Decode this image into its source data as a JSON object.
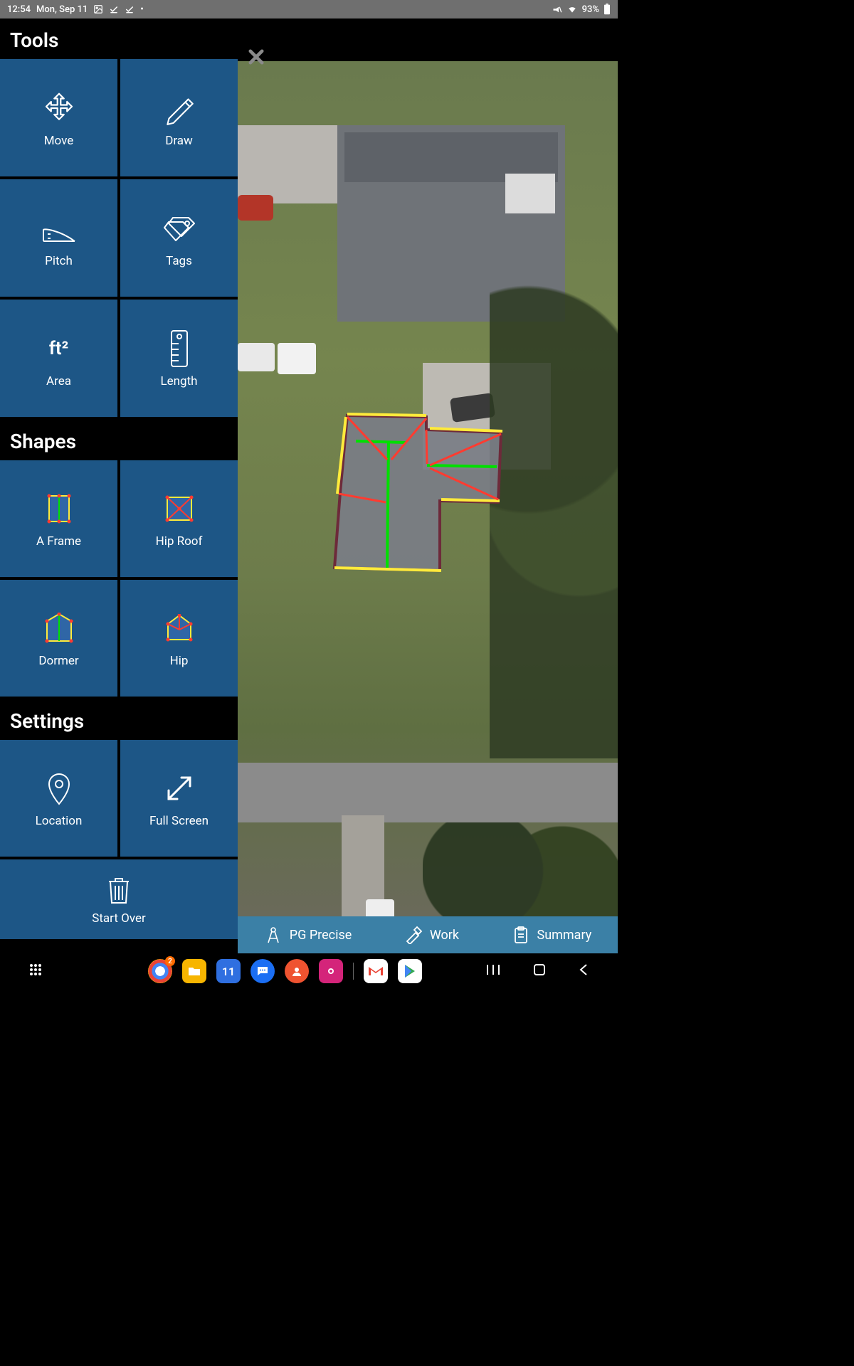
{
  "status_bar": {
    "time": "12:54",
    "date": "Mon, Sep 11",
    "battery_pct": "93%",
    "icons": {
      "mute": "mute-icon",
      "wifi": "wifi-icon",
      "battery": "battery-icon",
      "photo": "photo-icon",
      "check1": "check-icon",
      "check2": "check-icon",
      "dot": "•"
    }
  },
  "sidebar": {
    "sections": {
      "tools_title": "Tools",
      "shapes_title": "Shapes",
      "settings_title": "Settings"
    },
    "tools": [
      {
        "id": "move",
        "label": "Move",
        "icon": "move-icon"
      },
      {
        "id": "draw",
        "label": "Draw",
        "icon": "pencil-icon"
      },
      {
        "id": "pitch",
        "label": "Pitch",
        "icon": "protractor-icon"
      },
      {
        "id": "tags",
        "label": "Tags",
        "icon": "tags-icon"
      },
      {
        "id": "area",
        "label": "Area",
        "icon_text": "ft²"
      },
      {
        "id": "length",
        "label": "Length",
        "icon": "ruler-icon"
      }
    ],
    "shapes": [
      {
        "id": "a-frame",
        "label": "A Frame"
      },
      {
        "id": "hip-roof",
        "label": "Hip Roof"
      },
      {
        "id": "dormer",
        "label": "Dormer"
      },
      {
        "id": "hip",
        "label": "Hip"
      }
    ],
    "settings": [
      {
        "id": "location",
        "label": "Location",
        "icon": "pin-icon"
      },
      {
        "id": "full-screen",
        "label": "Full Screen",
        "icon": "expand-icon"
      }
    ],
    "start_over": {
      "label": "Start Over",
      "icon": "trash-icon"
    }
  },
  "tab_bar": {
    "tabs": [
      {
        "id": "pg-precise",
        "label": "PG Precise",
        "icon": "compass-icon"
      },
      {
        "id": "work",
        "label": "Work",
        "icon": "hammer-icon"
      },
      {
        "id": "summary",
        "label": "Summary",
        "icon": "clipboard-icon"
      }
    ]
  },
  "nav_bar": {
    "apps": [
      {
        "id": "chrome",
        "bg": "#ffffff"
      },
      {
        "id": "files",
        "bg": "#f7b500"
      },
      {
        "id": "calendar",
        "bg": "#2f6fe0",
        "text": "11"
      },
      {
        "id": "messages",
        "bg": "#1b6ef3"
      },
      {
        "id": "contacts",
        "bg": "#ef5330"
      },
      {
        "id": "camera",
        "bg": "#d4247a"
      },
      {
        "id": "gmail",
        "bg": "#ffffff"
      },
      {
        "id": "play",
        "bg": "#ffffff"
      }
    ]
  },
  "colors": {
    "tile": "#1d5686",
    "tab_bar": "#3b80a6",
    "roof_eave": "#ffeb3b",
    "roof_ridge": "#00e000",
    "roof_hip": "#ff3b30",
    "roof_fill": "#7a7d86",
    "roof_outline": "#6d2a3a"
  }
}
